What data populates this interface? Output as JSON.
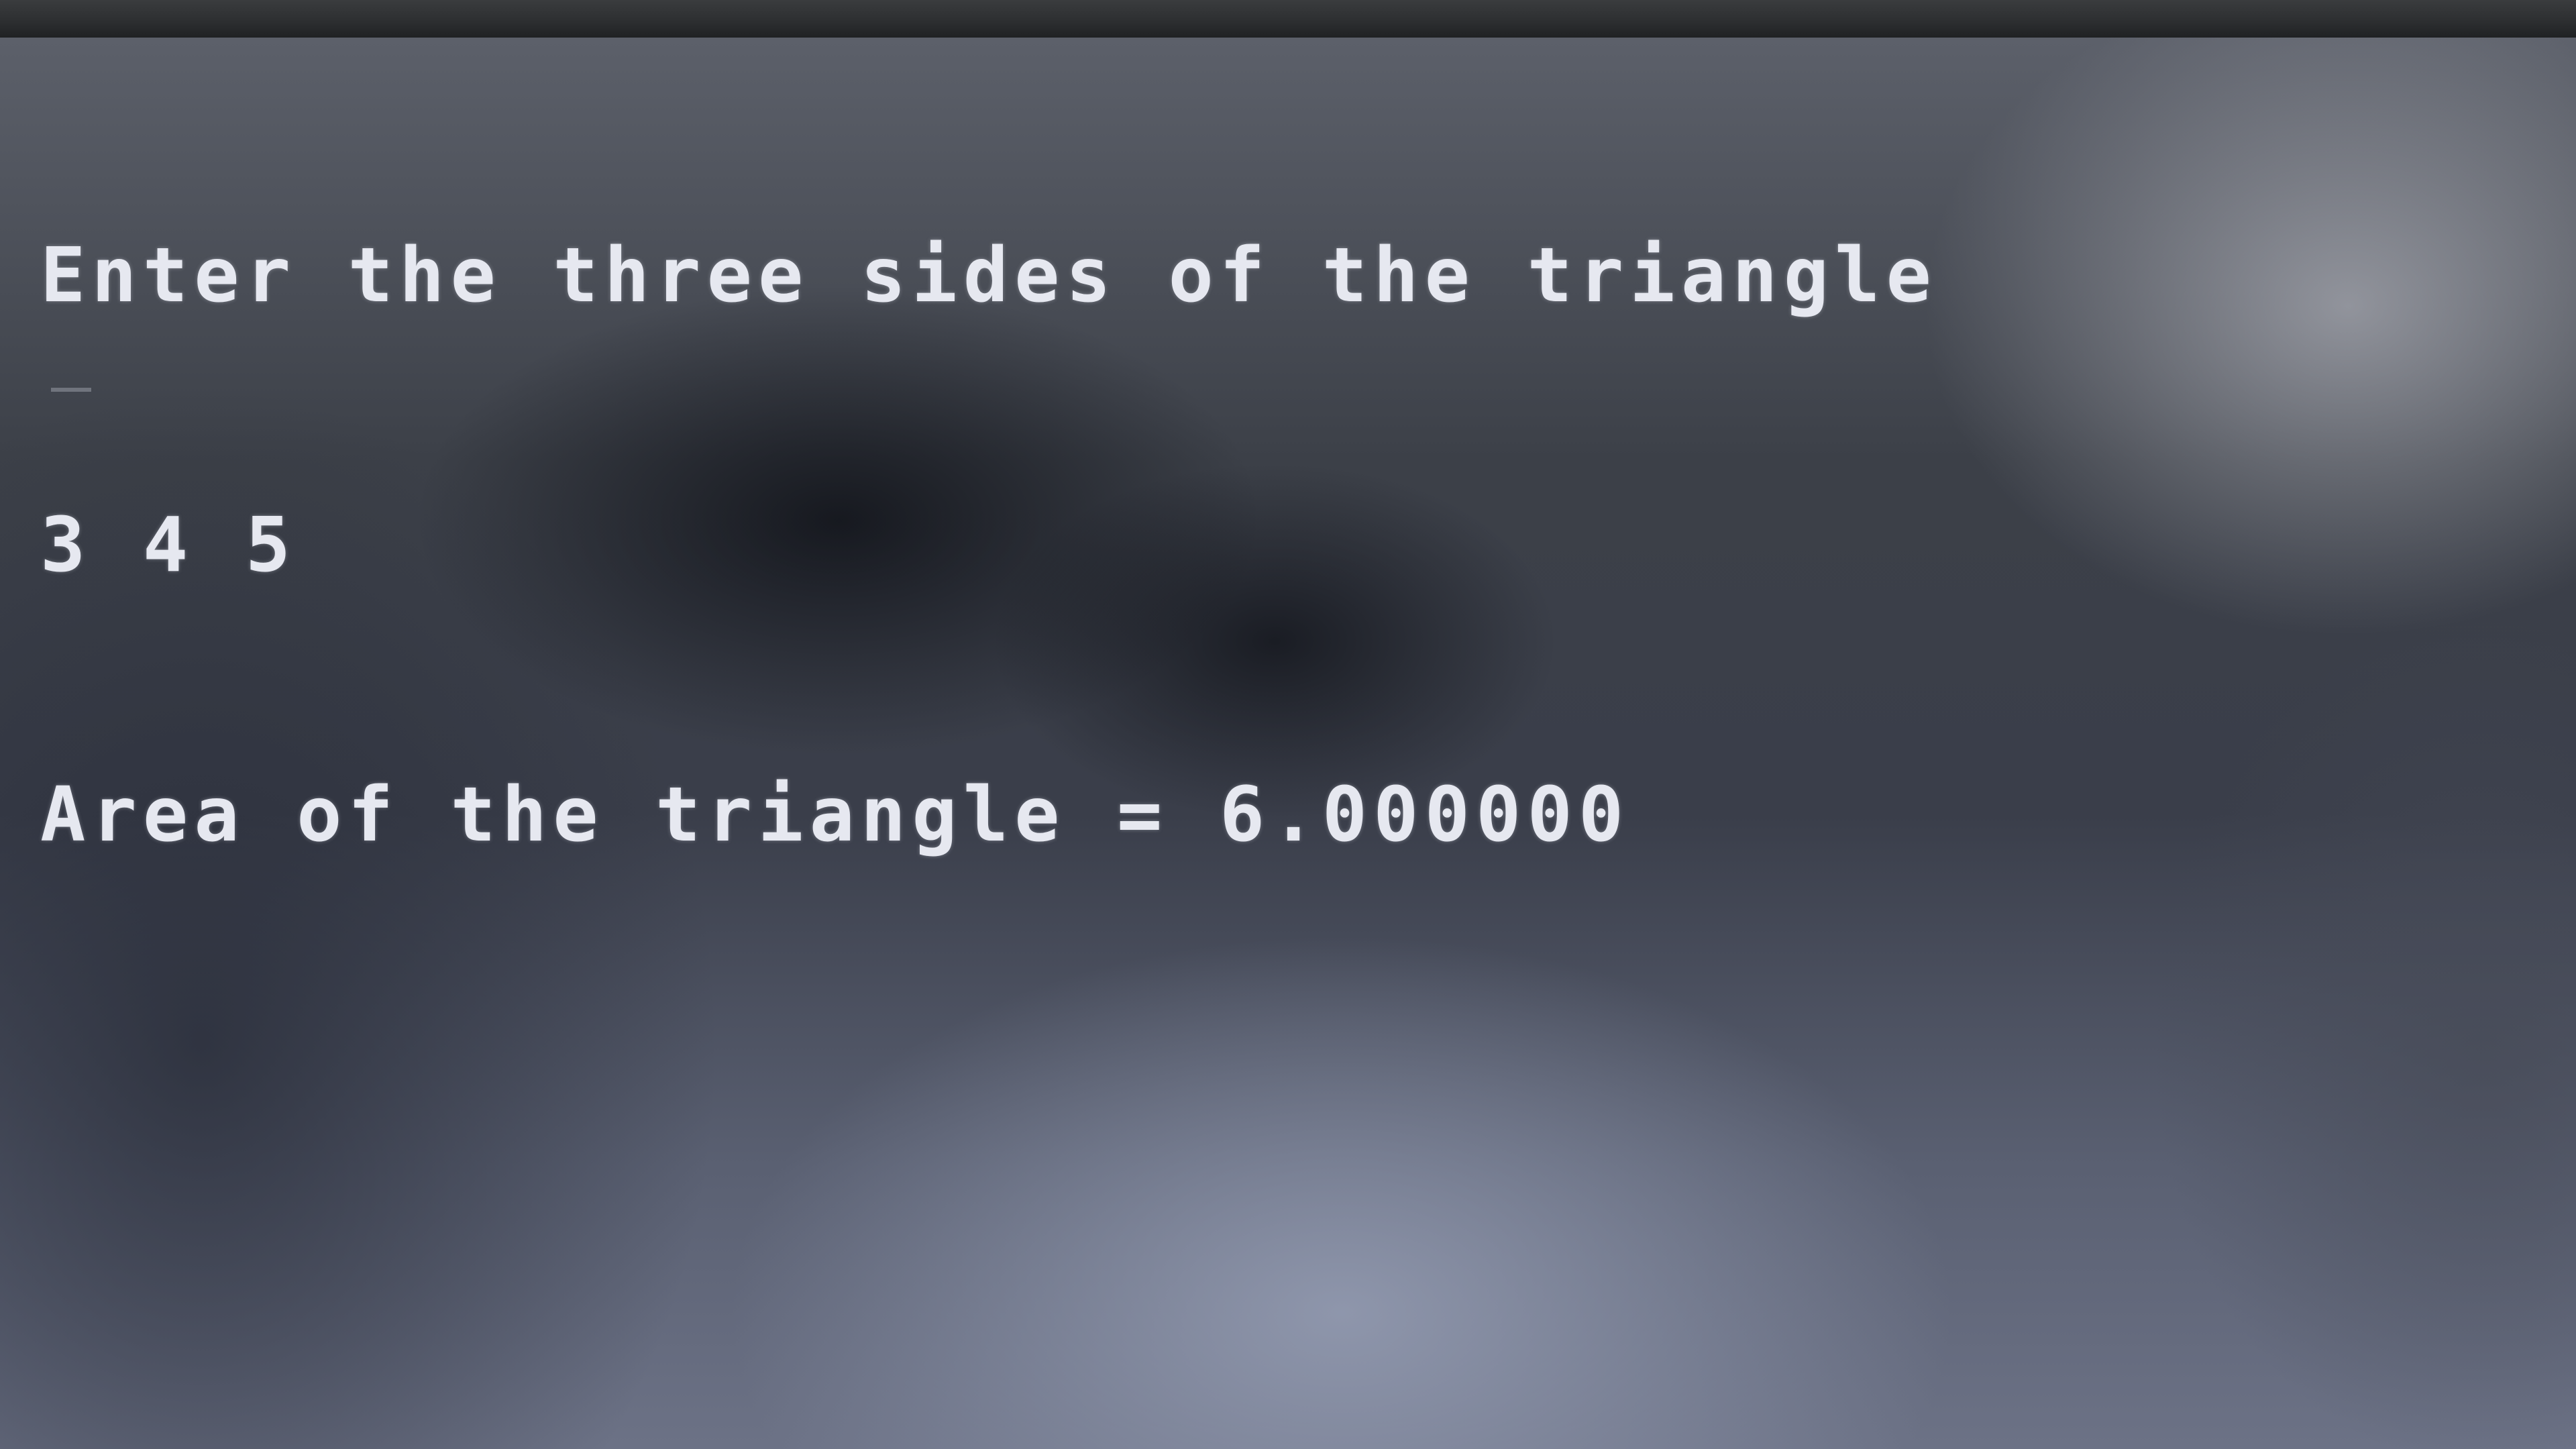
{
  "terminal": {
    "lines": [
      "Enter the three sides of the triangle",
      "3 4 5",
      "Area of the triangle = 6.000000"
    ]
  }
}
